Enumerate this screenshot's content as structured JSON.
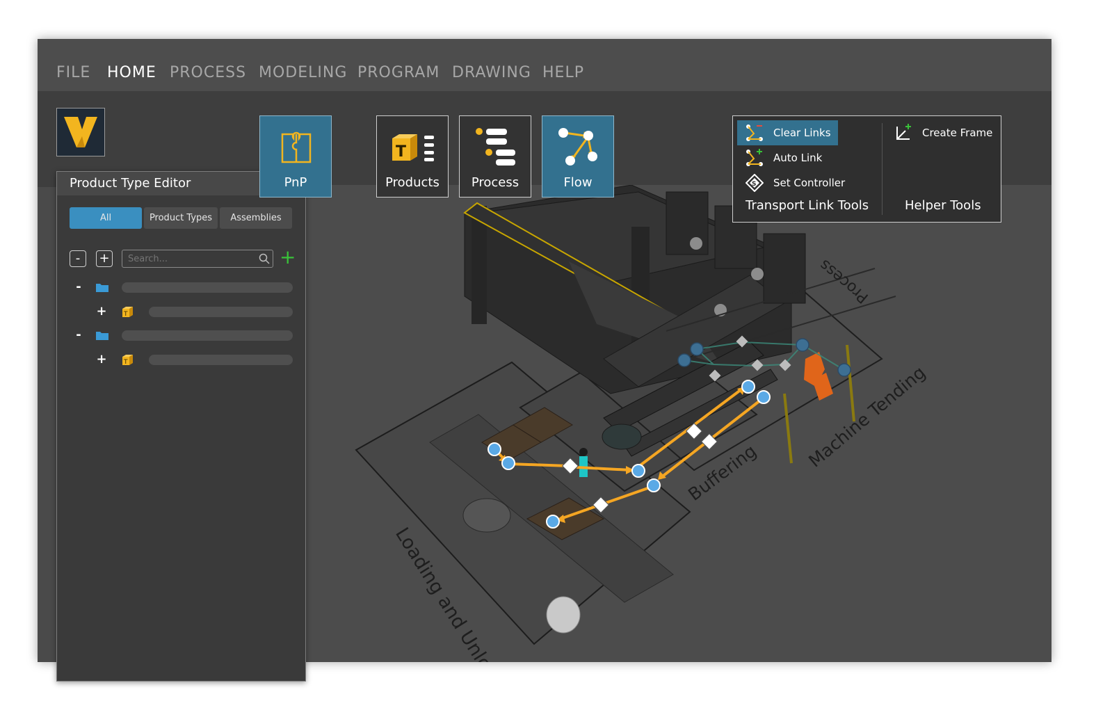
{
  "menu": [
    "FILE",
    "HOME",
    "PROCESS",
    "MODELING",
    "PROGRAM",
    "DRAWING",
    "HELP"
  ],
  "menu_active": "HOME",
  "panel": {
    "title": "Product Type Editor",
    "filters": [
      "All",
      "Product Types",
      "Assemblies"
    ],
    "active_filter": "All",
    "collapse_label": "-",
    "expand_label": "+",
    "search_placeholder": "Search...",
    "add_label": "+",
    "tree_expand": "+",
    "tree_collapse": "-"
  },
  "ribbon": {
    "pnp": "PnP",
    "products": "Products",
    "process": "Process",
    "flow": "Flow"
  },
  "tools": {
    "clear_links": "Clear Links",
    "auto_link": "Auto Link",
    "set_controller": "Set Controller",
    "create_frame": "Create Frame",
    "group_transport": "Transport Link Tools",
    "group_helper": "Helper Tools"
  },
  "scene": {
    "zone_loading": "Loading and Unloading",
    "zone_buffering": "Buffering",
    "zone_tending": "Machine Tending",
    "zone_process": "Process"
  },
  "colors": {
    "accent_blue": "#3a8fc0",
    "flow_orange": "#f5a623",
    "node_blue": "#5aa9e6",
    "logo_yellow": "#f2b51f",
    "add_green": "#39c239"
  }
}
